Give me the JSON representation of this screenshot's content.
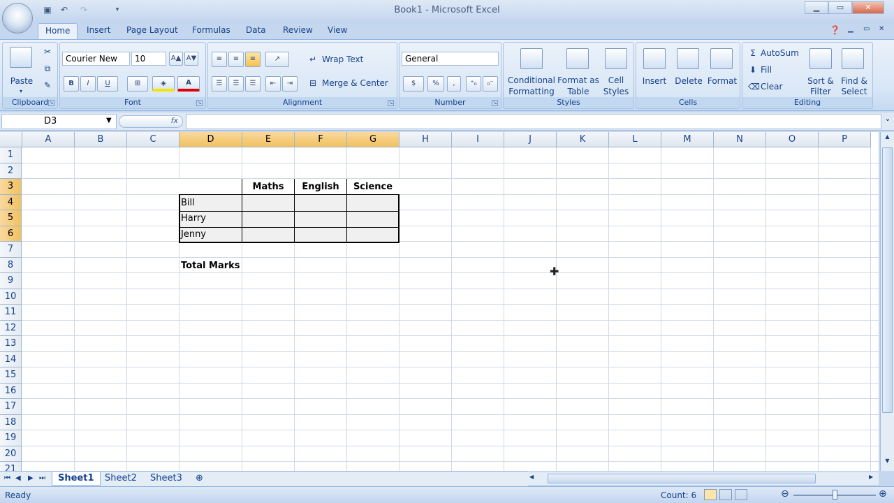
{
  "window": {
    "title": "Book1 - Microsoft Excel"
  },
  "tabs": [
    "Home",
    "Insert",
    "Page Layout",
    "Formulas",
    "Data",
    "Review",
    "View"
  ],
  "ribbon": {
    "clipboard": {
      "paste": "Paste",
      "label": "Clipboard"
    },
    "font": {
      "name": "Courier New",
      "size": "10",
      "bold": "B",
      "italic": "I",
      "underline": "U",
      "font_color": "A",
      "label": "Font"
    },
    "alignment": {
      "wrap_text": "Wrap Text",
      "merge_center": "Merge & Center",
      "label": "Alignment"
    },
    "number": {
      "format": "General",
      "currency": "$",
      "percent": "%",
      "comma": ",",
      "label": "Number"
    },
    "styles": {
      "conditional_1": "Conditional",
      "conditional_2": "Formatting",
      "format_table_1": "Format as",
      "format_table_2": "Table",
      "cell_styles_1": "Cell",
      "cell_styles_2": "Styles",
      "label": "Styles"
    },
    "cells": {
      "insert": "Insert",
      "delete": "Delete",
      "format": "Format",
      "label": "Cells"
    },
    "editing": {
      "autosum": "AutoSum",
      "fill": "Fill",
      "clear": "Clear",
      "sort_1": "Sort &",
      "sort_2": "Filter",
      "find_1": "Find &",
      "find_2": "Select",
      "label": "Editing"
    }
  },
  "formula_bar": {
    "name_box": "D3",
    "fx": "fx",
    "formula": ""
  },
  "columns": [
    "A",
    "B",
    "C",
    "D",
    "E",
    "F",
    "G",
    "H",
    "I",
    "J",
    "K",
    "L",
    "M",
    "N",
    "O",
    "P"
  ],
  "rows": [
    "1",
    "2",
    "3",
    "4",
    "5",
    "6",
    "7",
    "8",
    "9",
    "10",
    "11",
    "12",
    "13",
    "14",
    "15",
    "16",
    "17",
    "18",
    "19",
    "20",
    "21"
  ],
  "cells": {
    "E3": "Maths",
    "F3": "English",
    "G3": "Science",
    "D4": "Bill",
    "D5": "Harry",
    "D6": "Jenny",
    "D8": "Total Marks"
  },
  "sheets": [
    "Sheet1",
    "Sheet2",
    "Sheet3"
  ],
  "status": {
    "ready": "Ready",
    "count": "Count: 6"
  },
  "colors": {
    "selected_header": "#f1c15f",
    "ribbon": "#d8e6f6",
    "accent": "#15428b"
  }
}
